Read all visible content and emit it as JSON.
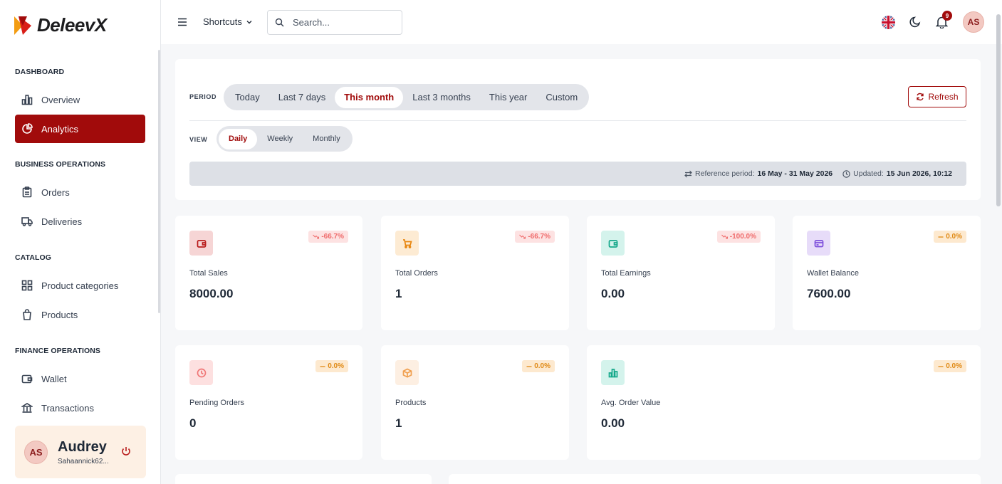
{
  "brand": {
    "name": "DeleevX"
  },
  "sidebar": {
    "sections": [
      {
        "title": "DASHBOARD",
        "items": [
          {
            "label": "Overview",
            "icon": "bar-chart-icon"
          },
          {
            "label": "Analytics",
            "icon": "pie-chart-icon",
            "active": true
          }
        ]
      },
      {
        "title": "BUSINESS OPERATIONS",
        "items": [
          {
            "label": "Orders",
            "icon": "clipboard-icon"
          },
          {
            "label": "Deliveries",
            "icon": "truck-icon"
          }
        ]
      },
      {
        "title": "CATALOG",
        "items": [
          {
            "label": "Product categories",
            "icon": "grid-icon"
          },
          {
            "label": "Products",
            "icon": "shopping-bag-icon"
          }
        ]
      },
      {
        "title": "FINANCE OPERATIONS",
        "items": [
          {
            "label": "Wallet",
            "icon": "wallet-icon"
          },
          {
            "label": "Transactions",
            "icon": "bank-icon"
          }
        ]
      }
    ],
    "user": {
      "initials": "AS",
      "name": "Audrey",
      "email": "Sahaannick62..."
    }
  },
  "topbar": {
    "shortcuts_label": "Shortcuts",
    "search_placeholder": "Search...",
    "notification_count": "9",
    "avatar_initials": "AS"
  },
  "filters": {
    "period_label": "PERIOD",
    "period_options": [
      "Today",
      "Last 7 days",
      "This month",
      "Last 3 months",
      "This year",
      "Custom"
    ],
    "period_selected": "This month",
    "view_label": "VIEW",
    "view_options": [
      "Daily",
      "Weekly",
      "Monthly"
    ],
    "view_selected": "Daily",
    "refresh_label": "Refresh",
    "reference_prefix": "Reference period:",
    "reference_value": "16 May - 31 May 2026",
    "updated_prefix": "Updated:",
    "updated_value": "15 Jun 2026, 10:12"
  },
  "stats": [
    {
      "name": "Total Sales",
      "value": "8000.00",
      "change": "-66.7%",
      "trend": "down",
      "icon": "wallet-icon",
      "bg": "#f6d5d5",
      "color": "#b91c1c"
    },
    {
      "name": "Total Orders",
      "value": "1",
      "change": "-66.7%",
      "trend": "down",
      "icon": "cart-icon",
      "bg": "#fdebd3",
      "color": "#e8860f"
    },
    {
      "name": "Total Earnings",
      "value": "0.00",
      "change": "-100.0%",
      "trend": "down",
      "icon": "wallet-icon",
      "bg": "#d4f3ec",
      "color": "#14a88a"
    },
    {
      "name": "Wallet Balance",
      "value": "7600.00",
      "change": "0.0%",
      "trend": "flat",
      "icon": "card-icon",
      "bg": "#e7dcf9",
      "color": "#7c4ddb"
    },
    {
      "name": "Pending Orders",
      "value": "0",
      "change": "0.0%",
      "trend": "flat",
      "icon": "clock-icon",
      "bg": "#fde0e0",
      "color": "#f07878"
    },
    {
      "name": "Products",
      "value": "1",
      "change": "0.0%",
      "trend": "flat",
      "icon": "box-icon",
      "bg": "#fdefe2",
      "color": "#f0a050"
    },
    {
      "name": "Avg. Order Value",
      "value": "0.00",
      "change": "0.0%",
      "trend": "flat",
      "icon": "bar-chart-icon",
      "bg": "#d4f3ec",
      "color": "#14a88a"
    }
  ],
  "colors": {
    "accent": "#a10b0b",
    "background": "#f6f7f9"
  }
}
